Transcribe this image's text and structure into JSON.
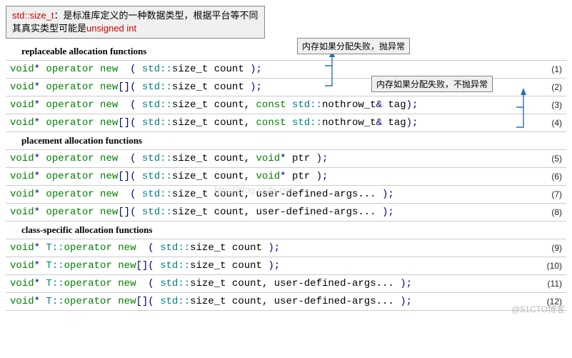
{
  "note": {
    "prefix": "std::size_t",
    "line1_rest": "：是标准库定义的一种数据类型，根据平台等不同",
    "line2_pre": "其真实类型可能是",
    "line2_red": "unsigned int"
  },
  "tips": {
    "throw": "内存如果分配失败，抛异常",
    "nothrow": "内存如果分配失败，不抛异常"
  },
  "sections": {
    "replaceable": "replaceable allocation functions",
    "placement": "placement allocation functions",
    "class_specific": "class-specific allocation functions"
  },
  "rows": [
    {
      "tokens": [
        [
          "kw",
          "void"
        ],
        [
          "punc",
          "*"
        ],
        [
          "ident",
          " "
        ],
        [
          "kw",
          "operator"
        ],
        [
          "ident",
          " "
        ],
        [
          "kw",
          "new"
        ],
        [
          "ident",
          "  "
        ],
        [
          "punc",
          "("
        ],
        [
          "ident",
          " "
        ],
        [
          "scope",
          "std::"
        ],
        [
          "ident",
          "size_t count "
        ],
        [
          "punc",
          ")"
        ],
        [
          "punc",
          ";"
        ]
      ],
      "num": "(1)"
    },
    {
      "tokens": [
        [
          "kw",
          "void"
        ],
        [
          "punc",
          "*"
        ],
        [
          "ident",
          " "
        ],
        [
          "kw",
          "operator"
        ],
        [
          "ident",
          " "
        ],
        [
          "kw",
          "new"
        ],
        [
          "punc",
          "[]"
        ],
        [
          "punc",
          "("
        ],
        [
          "ident",
          " "
        ],
        [
          "scope",
          "std::"
        ],
        [
          "ident",
          "size_t count "
        ],
        [
          "punc",
          ")"
        ],
        [
          "punc",
          ";"
        ]
      ],
      "num": "(2)"
    },
    {
      "tokens": [
        [
          "kw",
          "void"
        ],
        [
          "punc",
          "*"
        ],
        [
          "ident",
          " "
        ],
        [
          "kw",
          "operator"
        ],
        [
          "ident",
          " "
        ],
        [
          "kw",
          "new"
        ],
        [
          "ident",
          "  "
        ],
        [
          "punc",
          "("
        ],
        [
          "ident",
          " "
        ],
        [
          "scope",
          "std::"
        ],
        [
          "ident",
          "size_t count, "
        ],
        [
          "kw",
          "const"
        ],
        [
          "ident",
          " "
        ],
        [
          "scope",
          "std::"
        ],
        [
          "ident",
          "nothrow_t"
        ],
        [
          "punc",
          "&"
        ],
        [
          "ident",
          " tag"
        ],
        [
          "punc",
          ")"
        ],
        [
          "punc",
          ";"
        ]
      ],
      "num": "(3)"
    },
    {
      "tokens": [
        [
          "kw",
          "void"
        ],
        [
          "punc",
          "*"
        ],
        [
          "ident",
          " "
        ],
        [
          "kw",
          "operator"
        ],
        [
          "ident",
          " "
        ],
        [
          "kw",
          "new"
        ],
        [
          "punc",
          "[]"
        ],
        [
          "punc",
          "("
        ],
        [
          "ident",
          " "
        ],
        [
          "scope",
          "std::"
        ],
        [
          "ident",
          "size_t count, "
        ],
        [
          "kw",
          "const"
        ],
        [
          "ident",
          " "
        ],
        [
          "scope",
          "std::"
        ],
        [
          "ident",
          "nothrow_t"
        ],
        [
          "punc",
          "&"
        ],
        [
          "ident",
          " tag"
        ],
        [
          "punc",
          ")"
        ],
        [
          "punc",
          ";"
        ]
      ],
      "num": "(4)"
    },
    {
      "tokens": [
        [
          "kw",
          "void"
        ],
        [
          "punc",
          "*"
        ],
        [
          "ident",
          " "
        ],
        [
          "kw",
          "operator"
        ],
        [
          "ident",
          " "
        ],
        [
          "kw",
          "new"
        ],
        [
          "ident",
          "  "
        ],
        [
          "punc",
          "("
        ],
        [
          "ident",
          " "
        ],
        [
          "scope",
          "std::"
        ],
        [
          "ident",
          "size_t count, "
        ],
        [
          "kw",
          "void"
        ],
        [
          "punc",
          "*"
        ],
        [
          "ident",
          " ptr "
        ],
        [
          "punc",
          ")"
        ],
        [
          "punc",
          ";"
        ]
      ],
      "num": "(5)"
    },
    {
      "tokens": [
        [
          "kw",
          "void"
        ],
        [
          "punc",
          "*"
        ],
        [
          "ident",
          " "
        ],
        [
          "kw",
          "operator"
        ],
        [
          "ident",
          " "
        ],
        [
          "kw",
          "new"
        ],
        [
          "punc",
          "[]"
        ],
        [
          "punc",
          "("
        ],
        [
          "ident",
          " "
        ],
        [
          "scope",
          "std::"
        ],
        [
          "ident",
          "size_t count, "
        ],
        [
          "kw",
          "void"
        ],
        [
          "punc",
          "*"
        ],
        [
          "ident",
          " ptr "
        ],
        [
          "punc",
          ")"
        ],
        [
          "punc",
          ";"
        ]
      ],
      "num": "(6)"
    },
    {
      "tokens": [
        [
          "kw",
          "void"
        ],
        [
          "punc",
          "*"
        ],
        [
          "ident",
          " "
        ],
        [
          "kw",
          "operator"
        ],
        [
          "ident",
          " "
        ],
        [
          "kw",
          "new"
        ],
        [
          "ident",
          "  "
        ],
        [
          "punc",
          "("
        ],
        [
          "ident",
          " "
        ],
        [
          "scope",
          "std::"
        ],
        [
          "ident",
          "size_t count, user"
        ],
        [
          "punc",
          "-"
        ],
        [
          "ident",
          "defined"
        ],
        [
          "punc",
          "-"
        ],
        [
          "ident",
          "args... "
        ],
        [
          "punc",
          ")"
        ],
        [
          "punc",
          ";"
        ]
      ],
      "num": "(7)"
    },
    {
      "tokens": [
        [
          "kw",
          "void"
        ],
        [
          "punc",
          "*"
        ],
        [
          "ident",
          " "
        ],
        [
          "kw",
          "operator"
        ],
        [
          "ident",
          " "
        ],
        [
          "kw",
          "new"
        ],
        [
          "punc",
          "[]"
        ],
        [
          "punc",
          "("
        ],
        [
          "ident",
          " "
        ],
        [
          "scope",
          "std::"
        ],
        [
          "ident",
          "size_t count, user"
        ],
        [
          "punc",
          "-"
        ],
        [
          "ident",
          "defined"
        ],
        [
          "punc",
          "-"
        ],
        [
          "ident",
          "args... "
        ],
        [
          "punc",
          ")"
        ],
        [
          "punc",
          ";"
        ]
      ],
      "num": "(8)"
    },
    {
      "tokens": [
        [
          "kw",
          "void"
        ],
        [
          "punc",
          "*"
        ],
        [
          "ident",
          " "
        ],
        [
          "scope",
          "T::"
        ],
        [
          "kw",
          "operator"
        ],
        [
          "ident",
          " "
        ],
        [
          "kw",
          "new"
        ],
        [
          "ident",
          "  "
        ],
        [
          "punc",
          "("
        ],
        [
          "ident",
          " "
        ],
        [
          "scope",
          "std::"
        ],
        [
          "ident",
          "size_t count "
        ],
        [
          "punc",
          ")"
        ],
        [
          "punc",
          ";"
        ]
      ],
      "num": "(9)"
    },
    {
      "tokens": [
        [
          "kw",
          "void"
        ],
        [
          "punc",
          "*"
        ],
        [
          "ident",
          " "
        ],
        [
          "scope",
          "T::"
        ],
        [
          "kw",
          "operator"
        ],
        [
          "ident",
          " "
        ],
        [
          "kw",
          "new"
        ],
        [
          "punc",
          "[]"
        ],
        [
          "punc",
          "("
        ],
        [
          "ident",
          " "
        ],
        [
          "scope",
          "std::"
        ],
        [
          "ident",
          "size_t count "
        ],
        [
          "punc",
          ")"
        ],
        [
          "punc",
          ";"
        ]
      ],
      "num": "(10)"
    },
    {
      "tokens": [
        [
          "kw",
          "void"
        ],
        [
          "punc",
          "*"
        ],
        [
          "ident",
          " "
        ],
        [
          "scope",
          "T::"
        ],
        [
          "kw",
          "operator"
        ],
        [
          "ident",
          " "
        ],
        [
          "kw",
          "new"
        ],
        [
          "ident",
          "  "
        ],
        [
          "punc",
          "("
        ],
        [
          "ident",
          " "
        ],
        [
          "scope",
          "std::"
        ],
        [
          "ident",
          "size_t count, user"
        ],
        [
          "punc",
          "-"
        ],
        [
          "ident",
          "defined"
        ],
        [
          "punc",
          "-"
        ],
        [
          "ident",
          "args... "
        ],
        [
          "punc",
          ")"
        ],
        [
          "punc",
          ";"
        ]
      ],
      "num": "(11)"
    },
    {
      "tokens": [
        [
          "kw",
          "void"
        ],
        [
          "punc",
          "*"
        ],
        [
          "ident",
          " "
        ],
        [
          "scope",
          "T::"
        ],
        [
          "kw",
          "operator"
        ],
        [
          "ident",
          " "
        ],
        [
          "kw",
          "new"
        ],
        [
          "punc",
          "[]"
        ],
        [
          "punc",
          "("
        ],
        [
          "ident",
          " "
        ],
        [
          "scope",
          "std::"
        ],
        [
          "ident",
          "size_t count, user"
        ],
        [
          "punc",
          "-"
        ],
        [
          "ident",
          "defined"
        ],
        [
          "punc",
          "-"
        ],
        [
          "ident",
          "args... "
        ],
        [
          "punc",
          ")"
        ],
        [
          "punc",
          ";"
        ]
      ],
      "num": "(12)"
    }
  ],
  "watermark_center": "http://blog.csdn.net/",
  "footer": "@51CTO博客"
}
